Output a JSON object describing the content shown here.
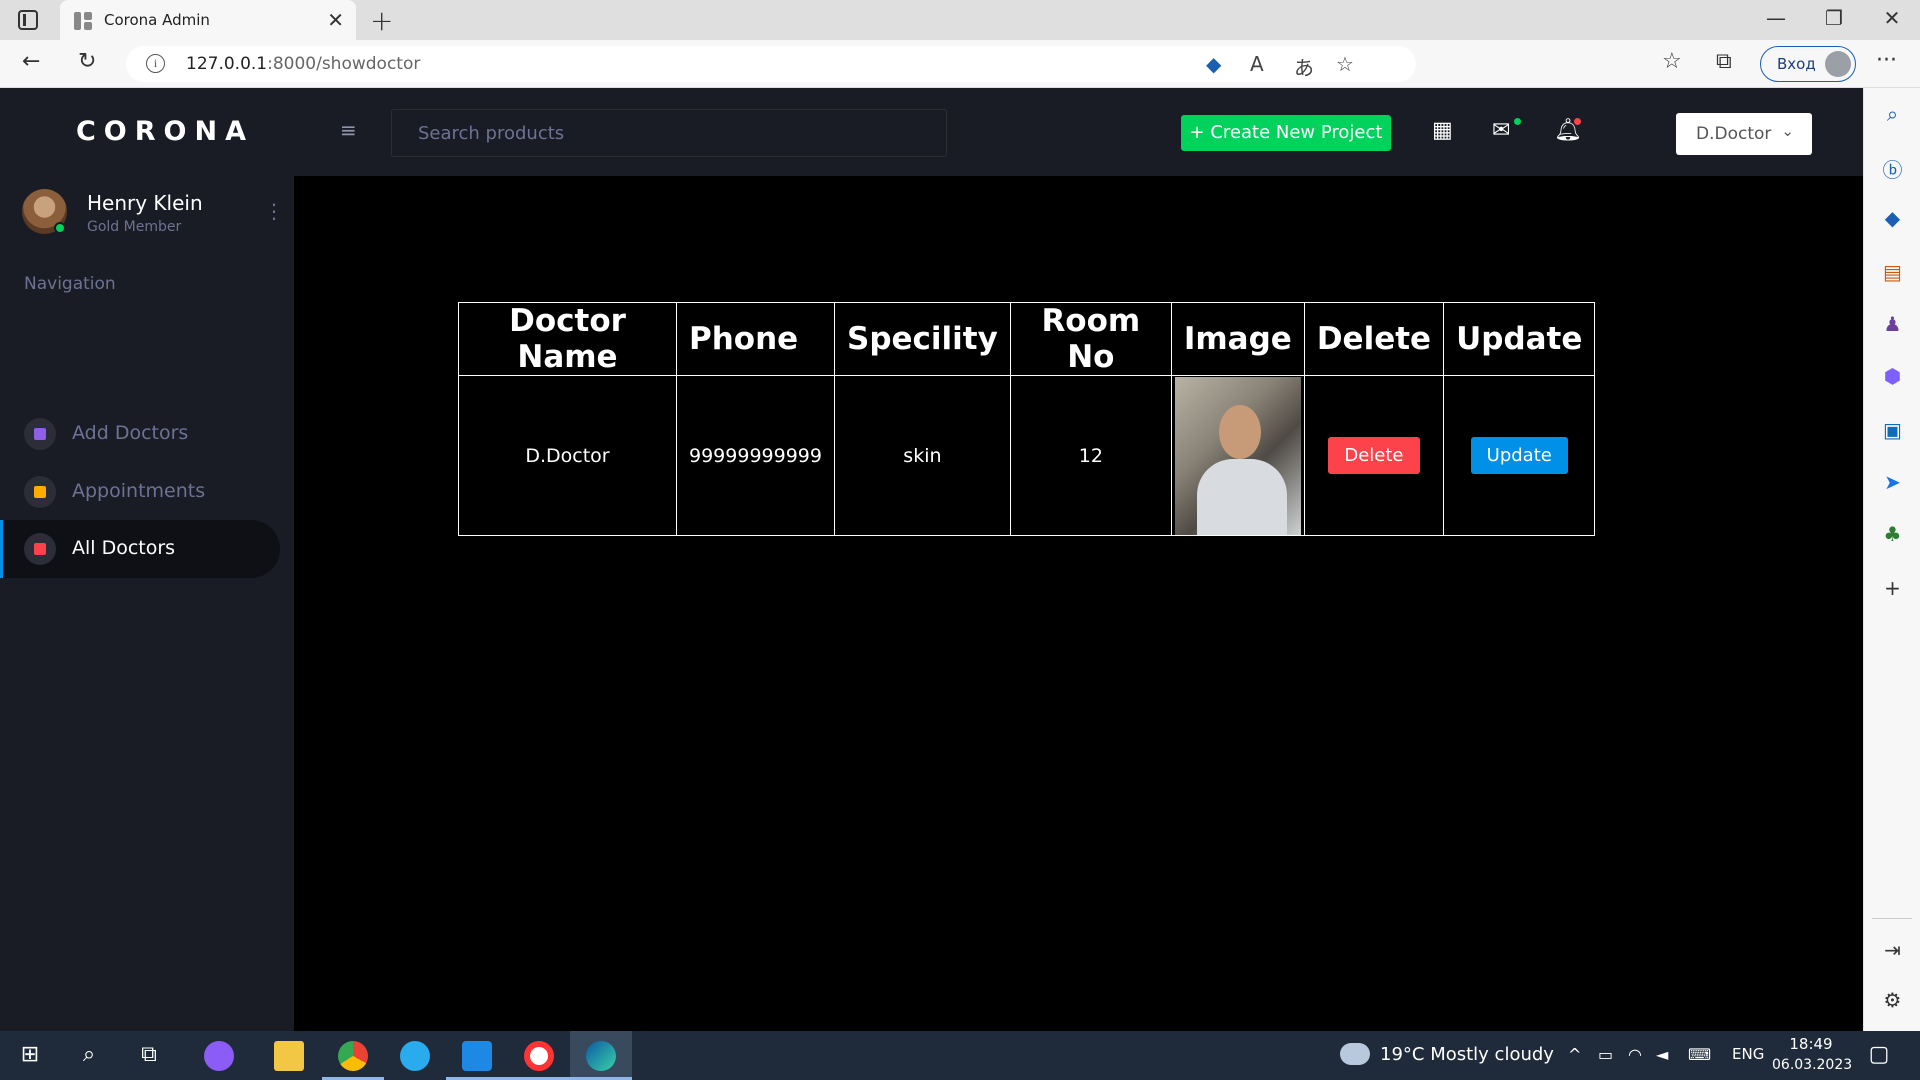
{
  "browser": {
    "tab_title": "Corona Admin",
    "url_host": "127.0.0.1",
    "url_path": ":8000/showdoctor",
    "login_label": "Вход"
  },
  "app": {
    "brand": "CORONA",
    "profile": {
      "name": "Henry Klein",
      "role": "Gold Member"
    },
    "nav_caption": "Navigation",
    "nav_items": [
      {
        "label": "Add Doctors",
        "color": "#8f5fe8"
      },
      {
        "label": "Appointments",
        "color": "#ffab00"
      },
      {
        "label": "All Doctors",
        "color": "#fc424a"
      }
    ],
    "search_placeholder": "Search products",
    "create_button": "+ Create New Project",
    "user_menu": "D.Doctor"
  },
  "table": {
    "headers": [
      "Doctor Name",
      "Phone",
      "Specility",
      "Room No",
      "Image",
      "Delete",
      "Update"
    ],
    "rows": [
      {
        "name": "D.Doctor",
        "phone": "99999999999",
        "speciality": "skin",
        "room": "12",
        "delete_label": "Delete",
        "update_label": "Update"
      }
    ]
  },
  "taskbar": {
    "weather": "19°C  Mostly cloudy",
    "lang": "ENG",
    "time": "18:49",
    "date": "06.03.2023"
  },
  "colors": {
    "accent_green": "#00d25b",
    "danger": "#fc424a",
    "primary": "#0090e7",
    "panel": "#191c24"
  }
}
